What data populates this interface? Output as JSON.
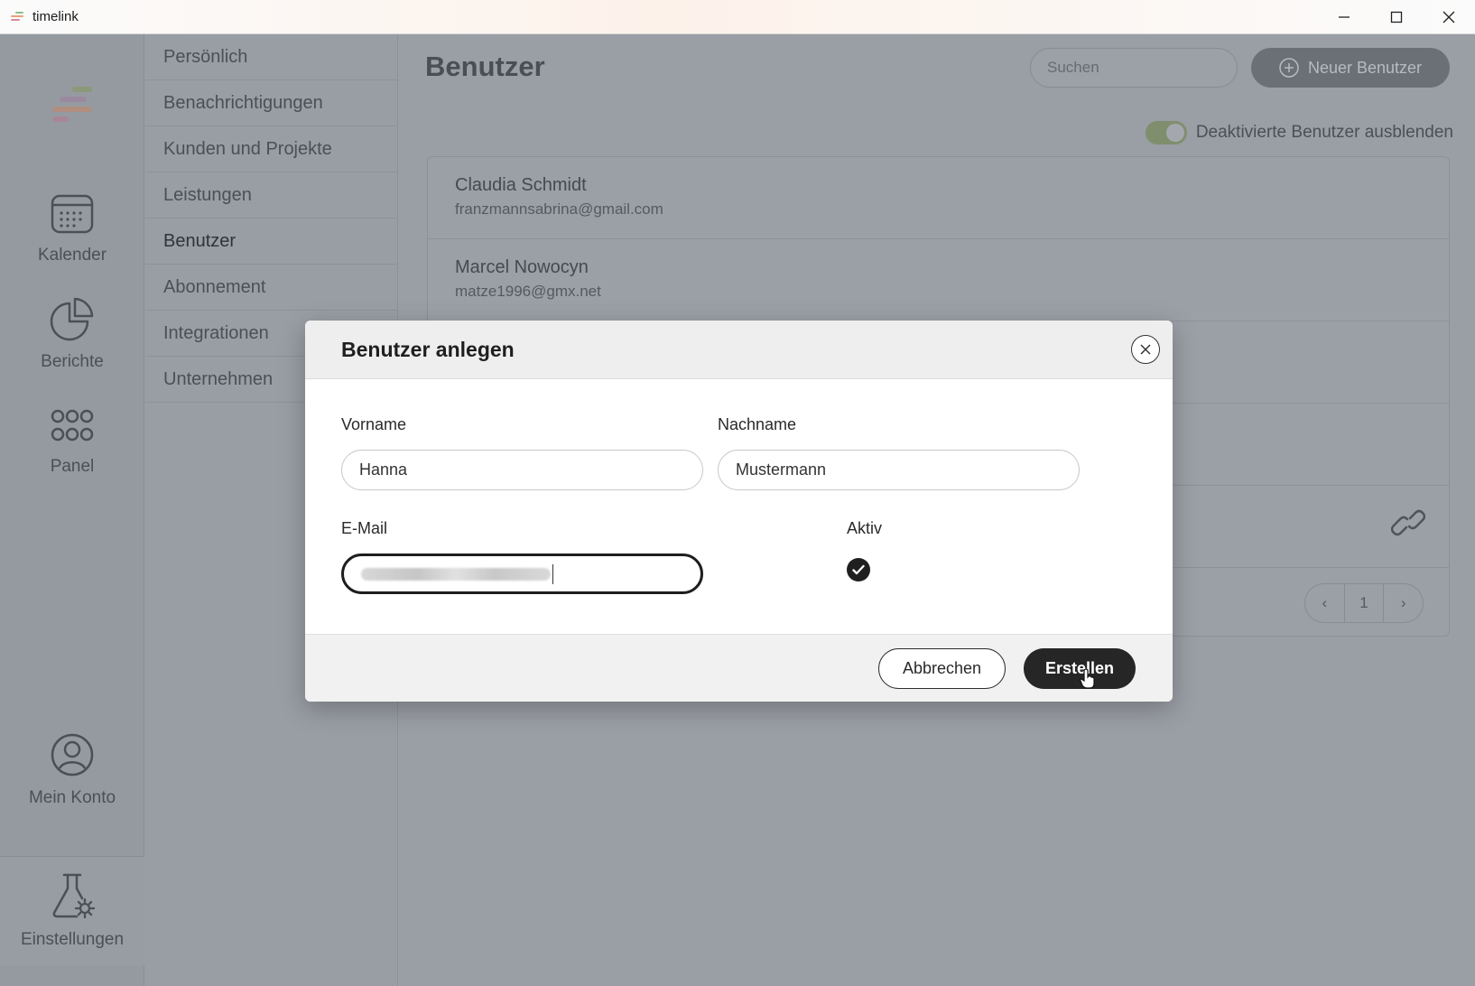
{
  "window": {
    "title": "timelink",
    "controls": [
      "minimize-icon",
      "maximize-icon",
      "close-icon"
    ]
  },
  "rail": {
    "items": [
      {
        "label": "Kalender",
        "icon": "calendar-icon"
      },
      {
        "label": "Berichte",
        "icon": "pie-chart-icon"
      },
      {
        "label": "Panel",
        "icon": "grid-dots-icon"
      },
      {
        "label": "Mein Konto",
        "icon": "user-circle-icon"
      },
      {
        "label": "Einstellungen",
        "icon": "flask-gear-icon"
      }
    ]
  },
  "settings_menu": {
    "items": [
      {
        "label": "Persönlich"
      },
      {
        "label": "Benachrichtigungen"
      },
      {
        "label": "Kunden und Projekte"
      },
      {
        "label": "Leistungen"
      },
      {
        "label": "Benutzer"
      },
      {
        "label": "Abonnement"
      },
      {
        "label": "Integrationen"
      },
      {
        "label": "Unternehmen"
      }
    ]
  },
  "main": {
    "title": "Benutzer",
    "search_placeholder": "Suchen",
    "new_user_label": "Neuer Benutzer",
    "toggle_label": "Deaktivierte Benutzer ausblenden",
    "users": [
      {
        "name": "Claudia Schmidt",
        "email": "franzmannsabrina@gmail.com"
      },
      {
        "name": "Marcel Nowocyn",
        "email": "matze1996@gmx.net"
      }
    ],
    "pager": {
      "prev": "‹",
      "page": "1",
      "next": "›"
    }
  },
  "dialog": {
    "title": "Benutzer anlegen",
    "first_name_label": "Vorname",
    "first_name_value": "Hanna",
    "last_name_label": "Nachname",
    "last_name_value": "Mustermann",
    "email_label": "E-Mail",
    "active_label": "Aktiv",
    "active_checked": true,
    "cancel_label": "Abbrechen",
    "create_label": "Erstellen"
  },
  "colors": {
    "overlay_bg": "#8f949c",
    "primary_button": "#262626",
    "toggle_on": "#7f8f6e"
  }
}
